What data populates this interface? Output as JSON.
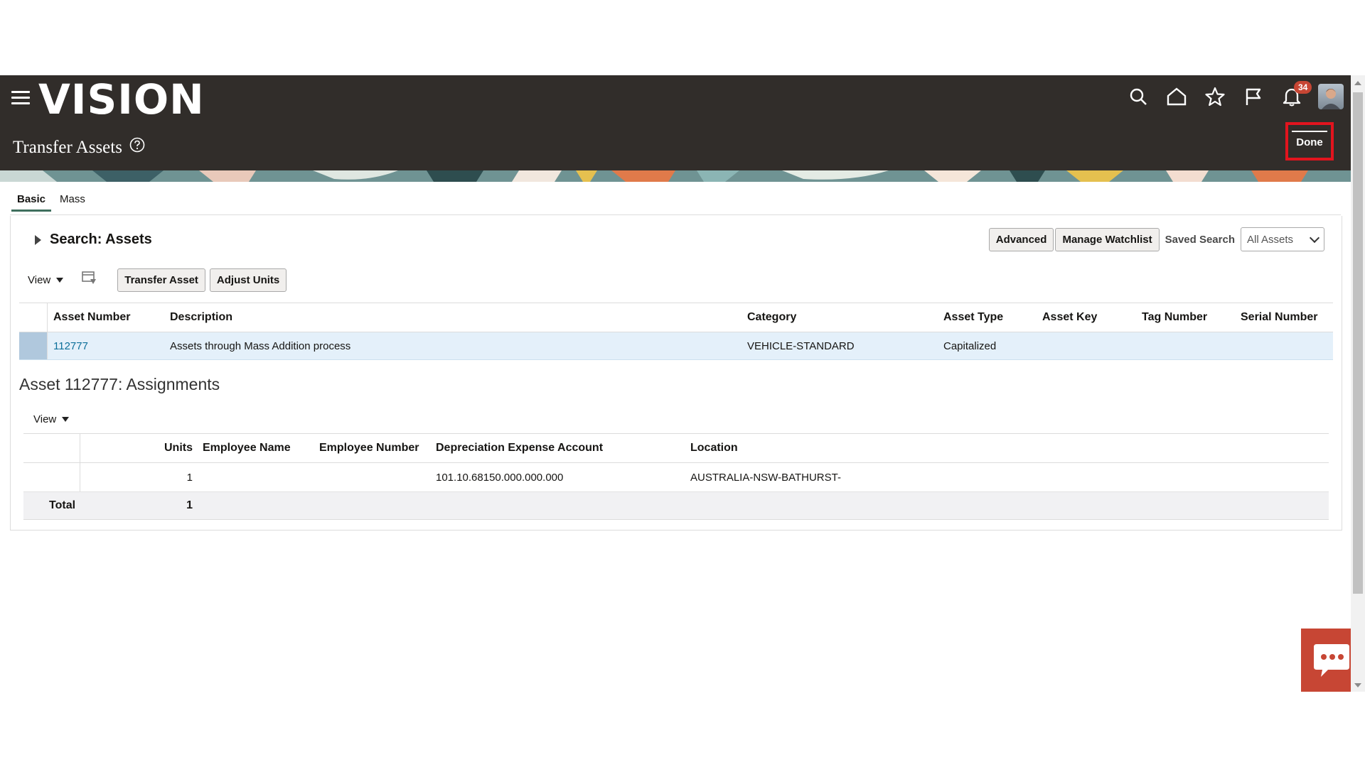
{
  "app": {
    "logo": "VISION",
    "notification_count": "34"
  },
  "page": {
    "title": "Transfer Assets",
    "done_label": "Done"
  },
  "tabs": [
    {
      "label": "Basic"
    },
    {
      "label": "Mass"
    }
  ],
  "search": {
    "title": "Search: Assets",
    "advanced_label": "Advanced",
    "watchlist_label": "Manage Watchlist",
    "saved_search_label": "Saved Search",
    "saved_search_value": "All Assets"
  },
  "assets_toolbar": {
    "view_label": "View",
    "transfer_label": "Transfer Asset",
    "adjust_label": "Adjust Units"
  },
  "assets_table": {
    "headers": [
      "Asset Number",
      "Description",
      "Category",
      "Asset Type",
      "Asset Key",
      "Tag Number",
      "Serial Number"
    ],
    "rows": [
      {
        "asset_number": "112777",
        "description": "Assets through Mass Addition process",
        "category": "VEHICLE-STANDARD",
        "asset_type": "Capitalized",
        "asset_key": "",
        "tag_number": "",
        "serial_number": ""
      }
    ]
  },
  "assignments": {
    "title": "Asset 112777: Assignments",
    "view_label": "View",
    "headers": [
      "Units",
      "Employee Name",
      "Employee Number",
      "Depreciation Expense Account",
      "Location"
    ],
    "rows": [
      {
        "units": "1",
        "employee_name": "",
        "employee_number": "",
        "account": "101.10.68150.000.000.000",
        "location": "AUSTRALIA-NSW-BATHURST-"
      }
    ],
    "total_label": "Total",
    "total_units": "1"
  },
  "colors": {
    "header_bg": "#312d2a",
    "highlight": "#e2141e",
    "selected_row": "#e4f0fa",
    "link": "#0c6f9a",
    "badge": "#c74634"
  }
}
